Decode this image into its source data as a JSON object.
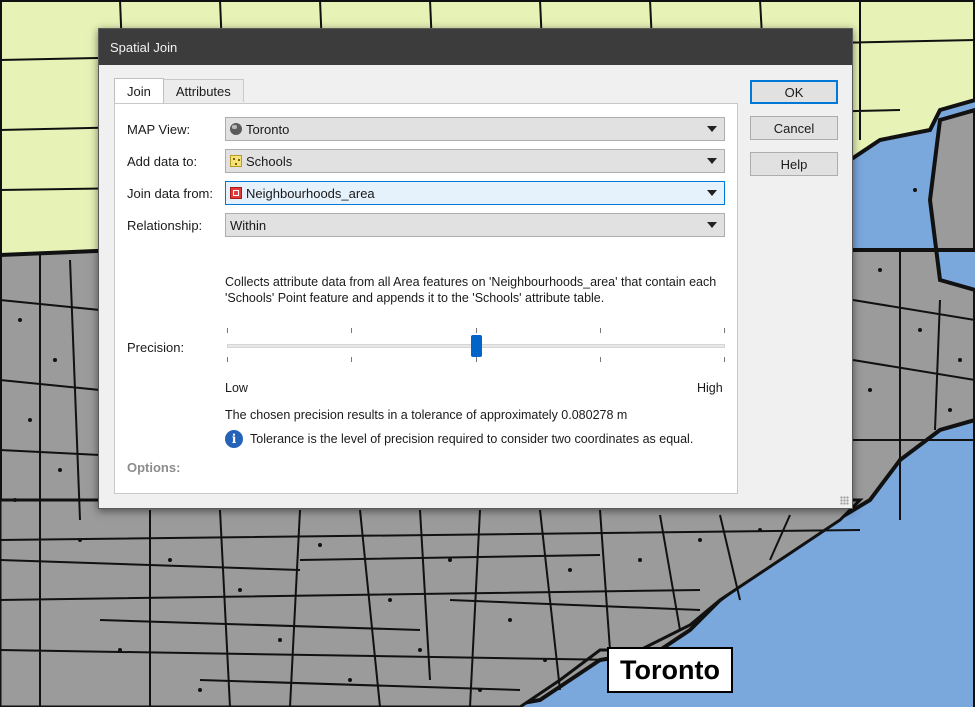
{
  "dialog": {
    "title": "Spatial Join",
    "tabs": [
      {
        "label": "Join",
        "active": true
      },
      {
        "label": "Attributes",
        "active": false
      }
    ],
    "fields": {
      "map_view": {
        "label": "MAP View:",
        "value": "Toronto",
        "icon": "globe-icon"
      },
      "add_data_to": {
        "label": "Add data to:",
        "value": "Schools",
        "icon": "point-layer-icon"
      },
      "join_data_from": {
        "label": "Join data from:",
        "value": "Neighbourhoods_area",
        "icon": "area-layer-icon"
      },
      "relationship": {
        "label": "Relationship:",
        "value": "Within"
      }
    },
    "description": "Collects attribute data from all Area features on 'Neighbourhoods_area' that contain each 'Schools' Point feature and appends it to the 'Schools' attribute table.",
    "precision": {
      "label": "Precision:",
      "low_label": "Low",
      "high_label": "High",
      "level": 0.5
    },
    "tolerance_text": "The chosen precision results in a tolerance of approximately 0.080278 m",
    "info_text": "Tolerance is the level of precision required to consider two coordinates as equal.",
    "options_label": "Options:",
    "buttons": {
      "ok": "OK",
      "cancel": "Cancel",
      "help": "Help"
    }
  },
  "map": {
    "label": "Toronto",
    "colors": {
      "water": "#7aa7dc",
      "land": "#9b9b9b",
      "outside": "#e6f2b6",
      "boundary": "#111111"
    }
  }
}
